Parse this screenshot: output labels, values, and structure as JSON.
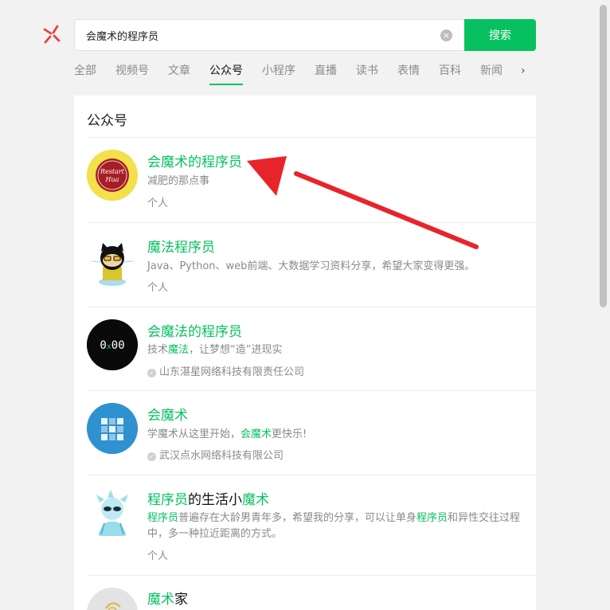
{
  "search": {
    "query": "会魔术的程序员",
    "clear_symbol": "×",
    "button_label": "搜索"
  },
  "tabs": [
    "全部",
    "视频号",
    "文章",
    "公众号",
    "小程序",
    "直播",
    "读书",
    "表情",
    "百科",
    "新闻"
  ],
  "active_tab": "公众号",
  "more_symbol": "›",
  "panel": {
    "title": "公众号"
  },
  "results": [
    {
      "name": "会魔术的程序员",
      "desc": "减肥的那点事",
      "meta": "个人",
      "avatar_text": "Restart Hua"
    },
    {
      "name": "魔法程序员",
      "desc": "Java、Python、web前端、大数据学习资料分享，希望大家变得更强。",
      "meta": "个人"
    },
    {
      "name": "会魔法的程序员",
      "desc_pre": "技术",
      "desc_hl": "魔法",
      "desc_post": "，让梦想“造”进现实",
      "meta": "山东湛星网络科技有限责任公司",
      "avatar_text": "0x00"
    },
    {
      "name": "会魔术",
      "desc_pre": "学魔术从这里开始，",
      "desc_hl": "会魔术",
      "desc_post": "更快乐!",
      "meta": "武汉点水网络科技有限公司"
    },
    {
      "name_hl1": "程序员",
      "name_plain": "的生活小",
      "name_hl2": "魔术",
      "desc_hl1": "程序员",
      "desc_mid": "普遍存在大龄男青年多，希望我的分享，可以让单身",
      "desc_hl2": "程序员",
      "desc_post": "和异性交往过程中，多一种拉近距离的方式。",
      "meta": "个人"
    },
    {
      "name_hl": "魔术",
      "name_plain": "家"
    }
  ],
  "colors": {
    "accent": "#07c160",
    "arrow": "#e8242b"
  }
}
